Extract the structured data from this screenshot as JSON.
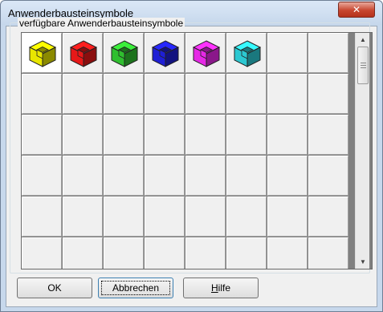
{
  "window": {
    "title": "Anwenderbausteinsymbole",
    "close_icon": "close-icon"
  },
  "group": {
    "label": "verfügbare Anwenderbausteinsymbole"
  },
  "symbols": [
    {
      "name": "yellow-block-icon",
      "color": "#e8e600"
    },
    {
      "name": "red-block-icon",
      "color": "#e61818"
    },
    {
      "name": "green-block-icon",
      "color": "#2fbf2f"
    },
    {
      "name": "blue-block-icon",
      "color": "#1f1fd6"
    },
    {
      "name": "magenta-block-icon",
      "color": "#e628e6"
    },
    {
      "name": "cyan-block-icon",
      "color": "#2cc8d2"
    }
  ],
  "buttons": {
    "ok": "OK",
    "cancel": "Abbrechen",
    "help_prefix": "H",
    "help_rest": "ilfe"
  }
}
